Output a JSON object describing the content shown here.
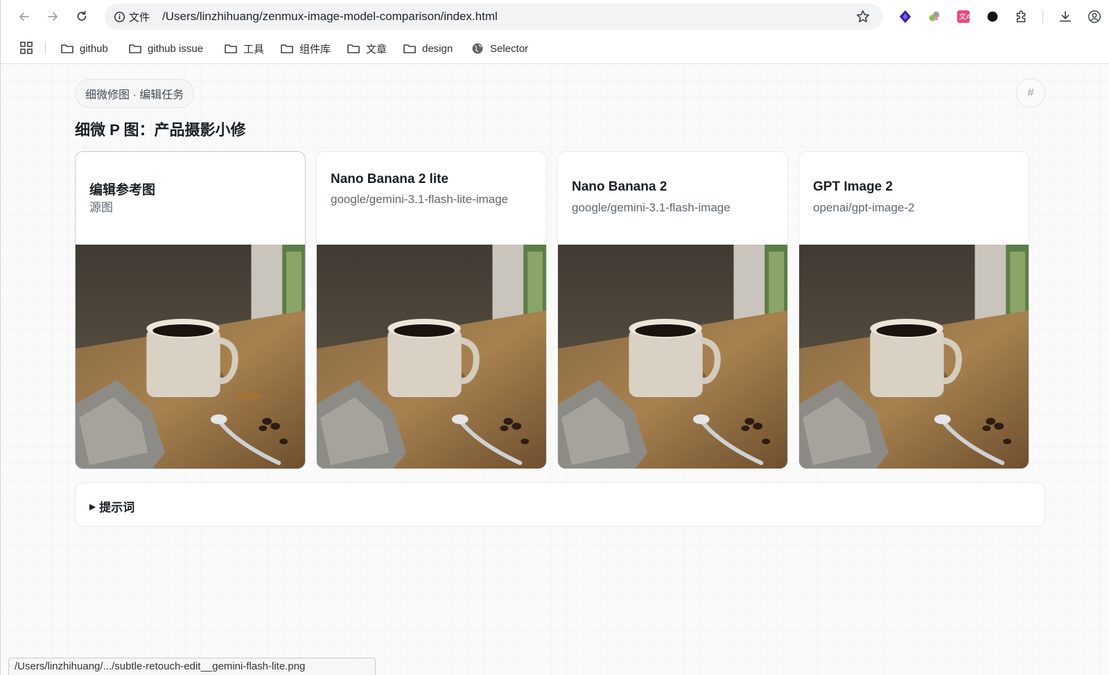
{
  "browser": {
    "site_chip_label": "文件",
    "url": "/Users/linzhihuang/zenmux-image-model-comparison/index.html",
    "bookmarks": [
      {
        "label": "github",
        "icon": "folder-icon"
      },
      {
        "label": "github issue",
        "icon": "folder-icon"
      },
      {
        "label": "工具",
        "icon": "folder-icon"
      },
      {
        "label": "组件库",
        "icon": "folder-icon"
      },
      {
        "label": "文章",
        "icon": "folder-icon"
      },
      {
        "label": "design",
        "icon": "folder-icon"
      },
      {
        "label": "Selector",
        "icon": "globe-icon"
      }
    ],
    "status_url": "/Users/linzhihuang/.../subtle-retouch-edit__gemini-flash-lite.png"
  },
  "page": {
    "task_chip": "细微修图 · 编辑任务",
    "hash_label": "#",
    "title": "细微 P 图：产品摄影小修",
    "cards": [
      {
        "title": "编辑参考图",
        "subtitle": "源图"
      },
      {
        "title": "Nano Banana 2 lite",
        "subtitle": "google/gemini-3.1-flash-lite-image"
      },
      {
        "title": "Nano Banana 2",
        "subtitle": "google/gemini-3.1-flash-image"
      },
      {
        "title": "GPT Image 2",
        "subtitle": "openai/gpt-image-2"
      }
    ],
    "prompt_toggle": "提示词"
  },
  "colors": {
    "accent_border": "#b9cfe6",
    "page_bg": "#fafafa"
  }
}
